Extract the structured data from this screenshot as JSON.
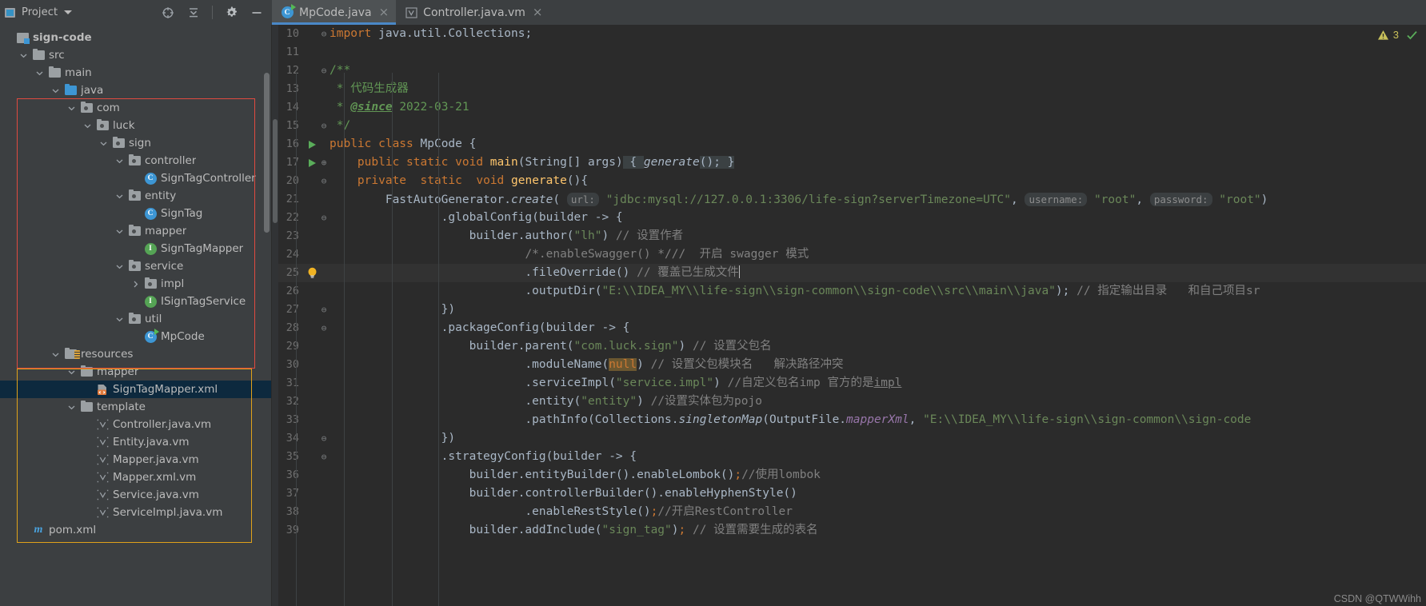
{
  "toolwindow": {
    "title": "Project",
    "icons": [
      "project-icon",
      "chevron-down-icon",
      "locate-icon",
      "collapse-all-icon",
      "settings-icon",
      "hide-icon"
    ]
  },
  "tabs": [
    {
      "label": "MpCode.java",
      "icon": "java-class-runnable-icon",
      "active": true,
      "close": "×"
    },
    {
      "label": "Controller.java.vm",
      "icon": "velocity-template-icon",
      "active": false,
      "close": "×"
    }
  ],
  "tree": [
    {
      "label": "sign-code",
      "depth": 0,
      "twisty": "",
      "icon": "module-icon",
      "bold": true
    },
    {
      "label": "src",
      "depth": 1,
      "twisty": "v",
      "icon": "folder-icon"
    },
    {
      "label": "main",
      "depth": 2,
      "twisty": "v",
      "icon": "folder-icon"
    },
    {
      "label": "java",
      "depth": 3,
      "twisty": "v",
      "icon": "source-root-icon"
    },
    {
      "label": "com",
      "depth": 4,
      "twisty": "v",
      "icon": "package-icon"
    },
    {
      "label": "luck",
      "depth": 5,
      "twisty": "v",
      "icon": "package-icon"
    },
    {
      "label": "sign",
      "depth": 6,
      "twisty": "v",
      "icon": "package-icon"
    },
    {
      "label": "controller",
      "depth": 7,
      "twisty": "v",
      "icon": "package-icon"
    },
    {
      "label": "SignTagController",
      "depth": 8,
      "twisty": "",
      "icon": "java-class-icon"
    },
    {
      "label": "entity",
      "depth": 7,
      "twisty": "v",
      "icon": "package-icon"
    },
    {
      "label": "SignTag",
      "depth": 8,
      "twisty": "",
      "icon": "java-class-icon"
    },
    {
      "label": "mapper",
      "depth": 7,
      "twisty": "v",
      "icon": "package-icon"
    },
    {
      "label": "SignTagMapper",
      "depth": 8,
      "twisty": "",
      "icon": "java-interface-icon"
    },
    {
      "label": "service",
      "depth": 7,
      "twisty": "v",
      "icon": "package-icon"
    },
    {
      "label": "impl",
      "depth": 8,
      "twisty": ">",
      "icon": "package-icon"
    },
    {
      "label": "ISignTagService",
      "depth": 8,
      "twisty": "",
      "icon": "java-interface-icon"
    },
    {
      "label": "util",
      "depth": 7,
      "twisty": "v",
      "icon": "package-icon"
    },
    {
      "label": "MpCode",
      "depth": 8,
      "twisty": "",
      "icon": "java-class-runnable-icon"
    },
    {
      "label": "resources",
      "depth": 3,
      "twisty": "v",
      "icon": "resources-root-icon"
    },
    {
      "label": "mapper",
      "depth": 4,
      "twisty": "v",
      "icon": "folder-icon"
    },
    {
      "label": "SignTagMapper.xml",
      "depth": 5,
      "twisty": "",
      "icon": "xml-file-icon",
      "selected": true
    },
    {
      "label": "template",
      "depth": 4,
      "twisty": "v",
      "icon": "folder-icon"
    },
    {
      "label": "Controller.java.vm",
      "depth": 5,
      "twisty": "",
      "icon": "velocity-template-icon"
    },
    {
      "label": "Entity.java.vm",
      "depth": 5,
      "twisty": "",
      "icon": "velocity-template-icon"
    },
    {
      "label": "Mapper.java.vm",
      "depth": 5,
      "twisty": "",
      "icon": "velocity-template-icon"
    },
    {
      "label": "Mapper.xml.vm",
      "depth": 5,
      "twisty": "",
      "icon": "velocity-template-icon"
    },
    {
      "label": "Service.java.vm",
      "depth": 5,
      "twisty": "",
      "icon": "velocity-template-icon"
    },
    {
      "label": "ServiceImpl.java.vm",
      "depth": 5,
      "twisty": "",
      "icon": "velocity-template-icon"
    },
    {
      "label": "pom.xml",
      "depth": 1,
      "twisty": "",
      "icon": "maven-pom-icon"
    }
  ],
  "highlights": {
    "java_box_color": "#e04a3f",
    "resources_box_color": "#e0a21a"
  },
  "editor": {
    "inspection_count": "3",
    "inspection_color": "#c9c15a",
    "lines": [
      {
        "num": "10",
        "fold": "⊖",
        "gutter": ""
      },
      {
        "num": "11",
        "fold": "",
        "gutter": ""
      },
      {
        "num": "12",
        "fold": "⊖",
        "gutter": ""
      },
      {
        "num": "13",
        "fold": "",
        "gutter": ""
      },
      {
        "num": "14",
        "fold": "",
        "gutter": ""
      },
      {
        "num": "15",
        "fold": "⊖",
        "gutter": ""
      },
      {
        "num": "16",
        "fold": "",
        "gutter": "run"
      },
      {
        "num": "17",
        "fold": "⊕",
        "gutter": "run"
      },
      {
        "num": "20",
        "fold": "⊖",
        "gutter": ""
      },
      {
        "num": "21",
        "fold": "",
        "gutter": ""
      },
      {
        "num": "22",
        "fold": "⊖",
        "gutter": ""
      },
      {
        "num": "23",
        "fold": "",
        "gutter": ""
      },
      {
        "num": "24",
        "fold": "",
        "gutter": ""
      },
      {
        "num": "25",
        "fold": "",
        "gutter": "bulb",
        "current": true
      },
      {
        "num": "26",
        "fold": "",
        "gutter": ""
      },
      {
        "num": "27",
        "fold": "⊖",
        "gutter": ""
      },
      {
        "num": "28",
        "fold": "⊖",
        "gutter": ""
      },
      {
        "num": "29",
        "fold": "",
        "gutter": ""
      },
      {
        "num": "30",
        "fold": "",
        "gutter": ""
      },
      {
        "num": "31",
        "fold": "",
        "gutter": ""
      },
      {
        "num": "32",
        "fold": "",
        "gutter": ""
      },
      {
        "num": "33",
        "fold": "",
        "gutter": ""
      },
      {
        "num": "34",
        "fold": "⊖",
        "gutter": ""
      },
      {
        "num": "35",
        "fold": "⊖",
        "gutter": ""
      },
      {
        "num": "36",
        "fold": "",
        "gutter": ""
      },
      {
        "num": "37",
        "fold": "",
        "gutter": ""
      },
      {
        "num": "38",
        "fold": "",
        "gutter": ""
      },
      {
        "num": "39",
        "fold": "",
        "gutter": ""
      }
    ],
    "source_text": [
      "import java.util.Collections;",
      "",
      "/**",
      " * 代码生成器",
      " * @since 2022-03-21",
      " */",
      "public class MpCode {",
      "    public static void main(String[] args) { generate(); }",
      "    private  static  void generate(){",
      "        FastAutoGenerator.create( url: \"jdbc:mysql://127.0.0.1:3306/life-sign?serverTimezone=UTC\",  username: \"root\",  password: \"root\")",
      "                .globalConfig(builder -> {",
      "                    builder.author(\"lh\") // 设置作者",
      "                            /*.enableSwagger() *///  开启 swagger 模式",
      "                            .fileOverride() // 覆盖已生成文件",
      "                            .outputDir(\"E:\\\\IDEA_MY\\\\life-sign\\\\sign-common\\\\sign-code\\\\src\\\\main\\\\java\"); // 指定输出目录   和自己项目sr",
      "                })",
      "                .packageConfig(builder -> {",
      "                    builder.parent(\"com.luck.sign\") // 设置父包名",
      "                            .moduleName(null) // 设置父包模块名   解决路径冲突",
      "                            .serviceImpl(\"service.impl\") //自定义包名imp 官方的是impl",
      "                            .entity(\"entity\") //设置实体包为pojo",
      "                            .pathInfo(Collections.singletonMap(OutputFile.mapperXml, \"E:\\\\IDEA_MY\\\\life-sign\\\\sign-common\\\\sign-code",
      "                })",
      "                .strategyConfig(builder -> {",
      "                    builder.entityBuilder().enableLombok();//使用lombok",
      "                    builder.controllerBuilder().enableHyphenStyle()",
      "                            .enableRestStyle();//开启RestController",
      "                    builder.addInclude(\"sign_tag\"); // 设置需要生成的表名"
    ]
  },
  "watermark": "CSDN @QTWWihh"
}
